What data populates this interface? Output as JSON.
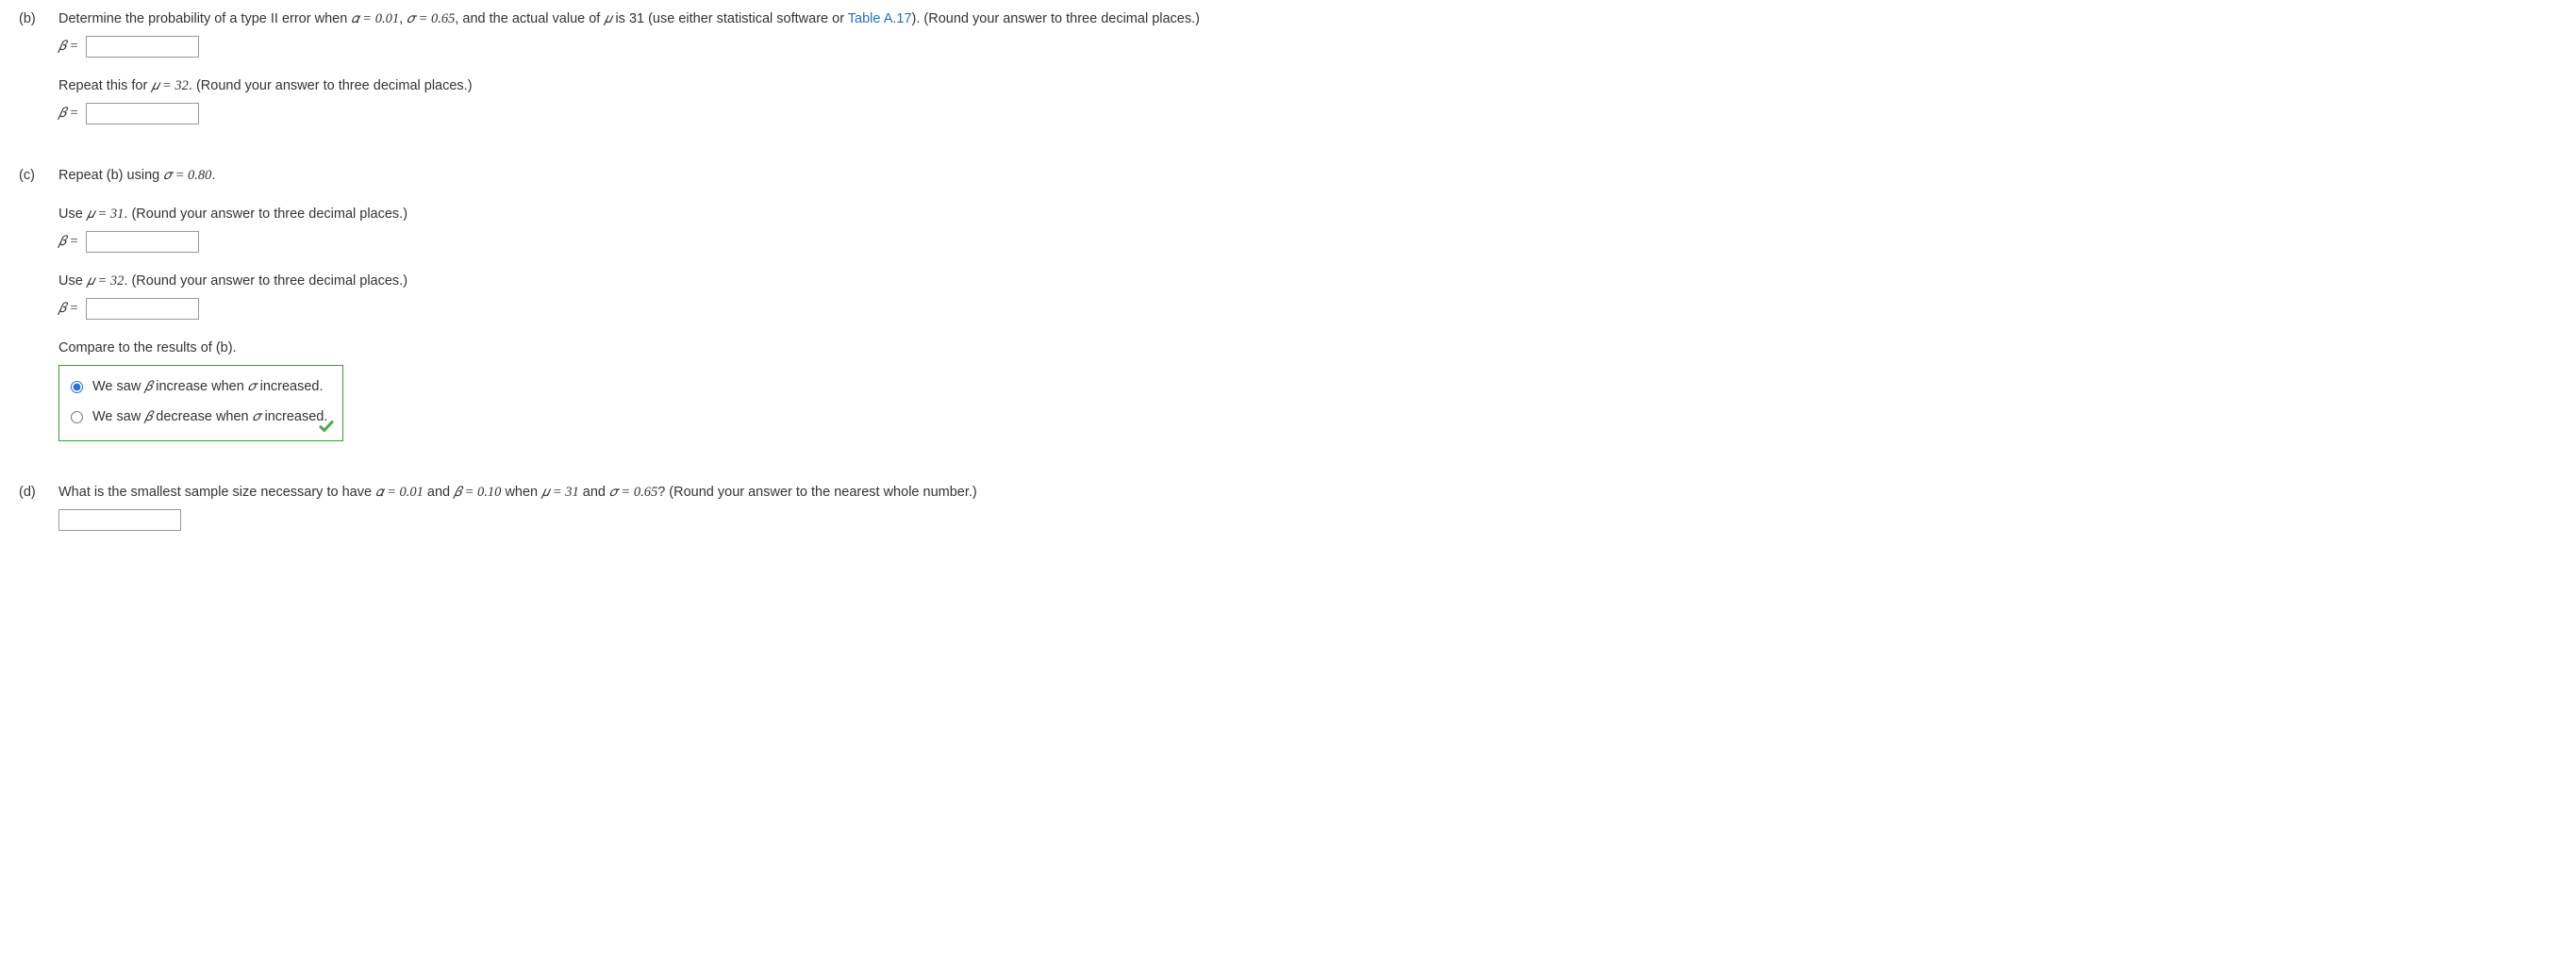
{
  "parts": {
    "b": {
      "label": "(b)",
      "prompt_pre": "Determine the probability of a type II error when ",
      "alpha": "𝛼 = 0.01",
      "sep1": ", ",
      "sigma": "𝜎 = 0.65",
      "sep2": ", and the actual value of ",
      "mu": "𝜇",
      "sep3": " is 31 (use either statistical software or ",
      "link": "Table A.17",
      "tail": "). (Round your answer to three decimal places.)",
      "beta_label": "𝛽 =",
      "repeat_line_pre": "Repeat this for ",
      "repeat_mu": "𝜇 = 32",
      "repeat_line_post": ". (Round your answer to three decimal places.)"
    },
    "c": {
      "label": "(c)",
      "prompt_pre": "Repeat (b) using ",
      "sigma": "𝜎 = 0.80",
      "prompt_post": ".",
      "use31_pre": "Use ",
      "use31_mu": "𝜇 = 31",
      "round_post": ". (Round your answer to three decimal places.)",
      "use32_pre": "Use ",
      "use32_mu": "𝜇 = 32",
      "compare": "Compare to the results of (b).",
      "opt1_pre": "We saw ",
      "opt1_beta": "𝛽",
      "opt1_mid": " increase when ",
      "opt1_sigma": "𝜎",
      "opt1_post": " increased.",
      "opt2_pre": "We saw ",
      "opt2_beta": "𝛽",
      "opt2_mid": " decrease when ",
      "opt2_sigma": "𝜎",
      "opt2_post": " increased."
    },
    "d": {
      "label": "(d)",
      "prompt_pre": "What is the smallest sample size necessary to have ",
      "alpha": "𝛼 = 0.01",
      "sep1": " and ",
      "beta": "𝛽 = 0.10",
      "sep2": " when ",
      "mu": "𝜇 = 31",
      "sep3": " and ",
      "sigma": "𝜎 = 0.65",
      "tail": "? (Round your answer to the nearest whole number.)"
    }
  },
  "beta_eq": "𝛽 ="
}
